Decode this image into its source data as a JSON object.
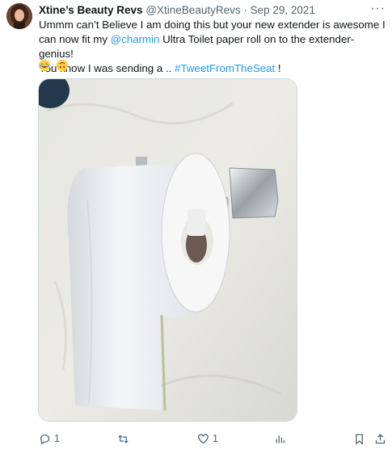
{
  "tweet": {
    "author_name": "Xtine’s Beauty Revs",
    "handle": "@XtineBeautyRevs",
    "separator": "·",
    "date": "Sep 29, 2021",
    "more_label": "···",
    "line1": "Ummm can’t Believe I am doing this but your new extender is awesome I",
    "line2_a": "can now fit my ",
    "mention": "@charmin",
    "line2_b": " Ultra Toilet paper roll on to the extender- genius!",
    "line3_a": "You know I was sending a .. ",
    "hashtag": "#TweetFromTheSeat",
    "line3_b": " !",
    "emojis": [
      "laughing-crying-emoji",
      "upside-down-face-emoji"
    ]
  },
  "actions": {
    "reply_count": "1",
    "retweet_count": "",
    "like_count": "1",
    "views_count": ""
  },
  "colors": {
    "link": "#1d9bf0",
    "secondary_text": "#536471"
  }
}
